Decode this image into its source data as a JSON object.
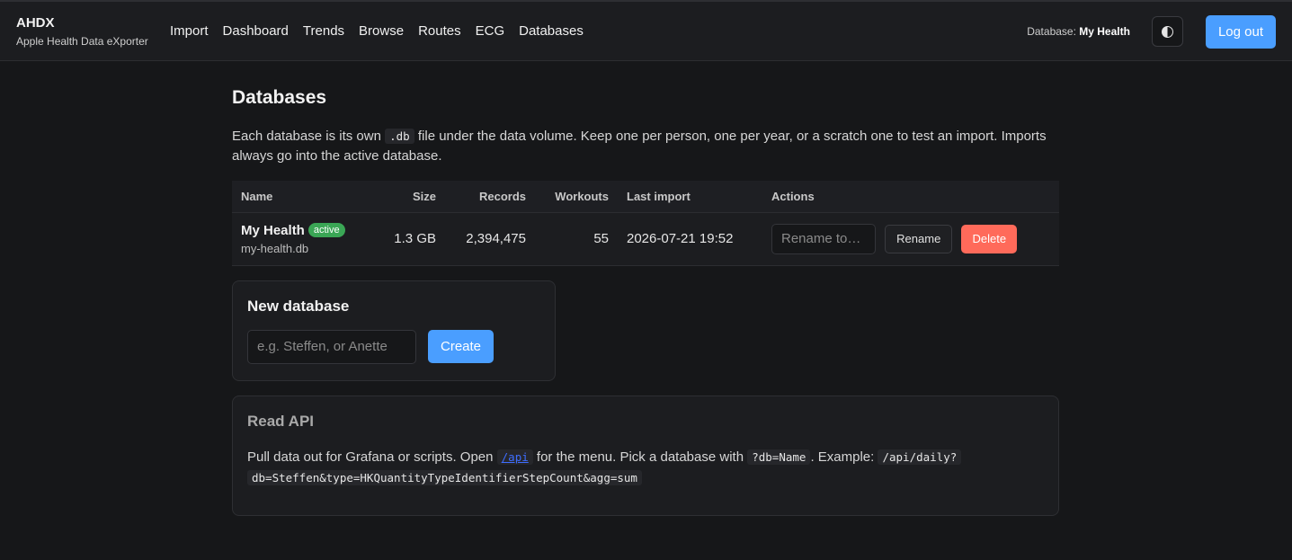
{
  "app": {
    "title": "AHDX",
    "subtitle": "Apple Health Data eXporter"
  },
  "nav": [
    {
      "label": "Import"
    },
    {
      "label": "Dashboard"
    },
    {
      "label": "Trends"
    },
    {
      "label": "Browse"
    },
    {
      "label": "Routes"
    },
    {
      "label": "ECG"
    },
    {
      "label": "Databases"
    }
  ],
  "header": {
    "database_prefix": "Database:",
    "database_name": "My Health",
    "theme_icon": "contrast-icon",
    "logout_label": "Log out"
  },
  "page": {
    "title": "Databases",
    "intro_before": "Each database is its own ",
    "intro_code": ".db",
    "intro_after": " file under the data volume. Keep one per person, one per year, or a scratch one to test an import. Imports always go into the active database."
  },
  "table": {
    "headers": {
      "name": "Name",
      "size": "Size",
      "records": "Records",
      "workouts": "Workouts",
      "last_import": "Last import",
      "actions": "Actions"
    },
    "rows": [
      {
        "name": "My Health",
        "badge": "active",
        "file": "my-health.db",
        "size": "1.3 GB",
        "records": "2,394,475",
        "workouts": "55",
        "last_import": "2026-07-21 19:52",
        "rename_placeholder": "Rename to…",
        "rename_label": "Rename",
        "delete_label": "Delete"
      }
    ]
  },
  "new_db": {
    "title": "New database",
    "placeholder": "e.g. Steffen, or Anette",
    "create_label": "Create"
  },
  "api": {
    "title": "Read API",
    "text_1": "Pull data out for Grafana or scripts. Open ",
    "link": "/api",
    "text_2": " for the menu. Pick a database with ",
    "code_1": "?db=Name",
    "text_3": ". Example: ",
    "code_2a": "/api/daily?",
    "code_2b": "db=Steffen&type=HKQuantityTypeIdentifierStepCount&agg=sum"
  },
  "colors": {
    "background": "#161719",
    "accent": "#4a9eff",
    "active_badge": "#3aa655",
    "danger": "#ff6a5a"
  }
}
